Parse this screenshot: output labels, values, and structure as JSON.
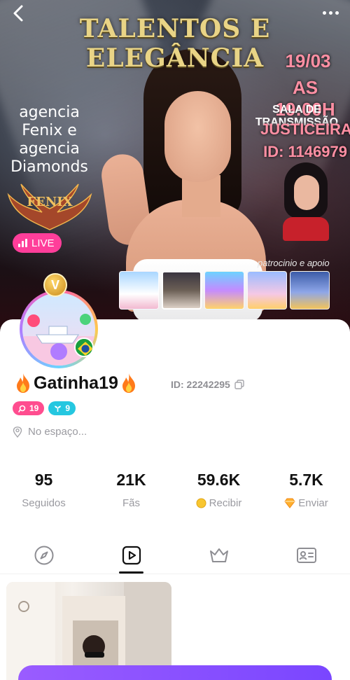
{
  "banner": {
    "title": "TALENTOS E ELEGÂNCIA",
    "date": "19/03",
    "time": "AS 19:00H",
    "room_label": "SALA DE TRANSMISSÃO",
    "room_name": "JUSTICEIRA",
    "room_id": "ID: 1146979",
    "agency_text": "agencia Fenix e agencia Diamonds",
    "agency_logo": "FENIX",
    "sponsor": "patrocinio e apoio",
    "live_label": "LIVE",
    "thumbnails": [
      "yacht",
      "talentos-e-elegancia-poster",
      "rainbow-unicorn",
      "carousel-horse",
      "trophy-castle"
    ]
  },
  "profile": {
    "name": "Gatinha19",
    "user_id": "ID: 22242295",
    "avatar_badge": "V",
    "level_badge": "19",
    "fan_badge": "9",
    "location": "No espaço..."
  },
  "stats": [
    {
      "value": "95",
      "label": "Seguidos"
    },
    {
      "value": "21K",
      "label": "Fãs"
    },
    {
      "value": "59.6K",
      "label": "Recibir"
    },
    {
      "value": "5.7K",
      "label": "Enviar"
    }
  ],
  "tabs": [
    "compass-icon",
    "video-icon",
    "crown-icon",
    "id-card-icon"
  ],
  "colors": {
    "live_pink": "#ff3e9a",
    "banner_title_gold": "#e9d486",
    "banner_pink_text": "#ff8fa3",
    "badge_pink": "#ff4d8f",
    "badge_cyan": "#25c7e0",
    "bottom_bar_purple": "#8a50ff"
  }
}
